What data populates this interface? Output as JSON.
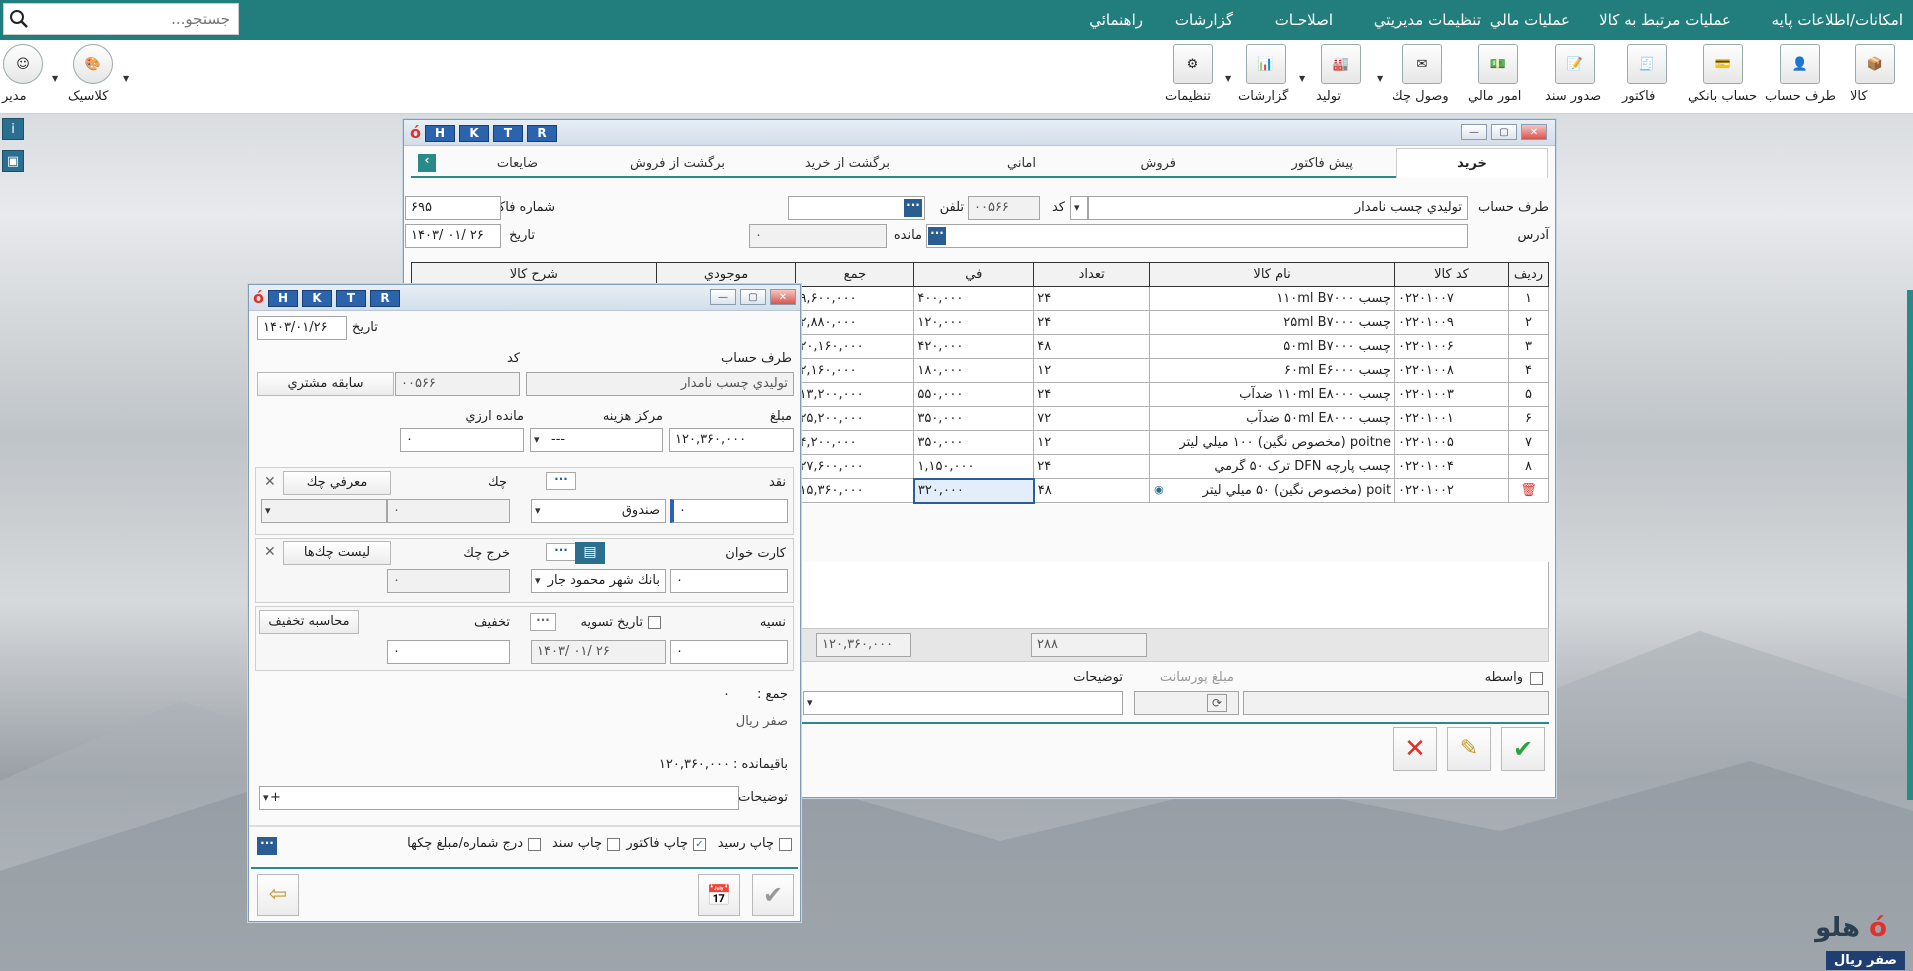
{
  "search": {
    "placeholder": "جستجو..."
  },
  "menu": [
    "امکانات/اطلاعات پايه",
    "عمليات مرتبط به کالا",
    "عمليات مالي",
    "تنظيمات مديريتي",
    "اصلاحـات",
    "گزارشات",
    "راهنمائي"
  ],
  "toolbar": {
    "items": [
      "کالا",
      "طرف حساب",
      "حساب بانکي",
      "فاکتور",
      "صدور سند",
      "امور مالي",
      "وصول چك",
      "توليد",
      "گزارشات",
      "تنظيمات"
    ],
    "theme": "کلاسيک",
    "user": "مدير"
  },
  "hk": [
    "H",
    "K",
    "T",
    "R"
  ],
  "main": {
    "tabs": [
      "خريد",
      "پيش فاکتور",
      "فروش",
      "اماني",
      "برگشت از خريد",
      "برگشت از فروش",
      "ضايعات"
    ],
    "party_label": "طرف حساب",
    "party": "توليدي چسب نامدار",
    "code_label": "کد",
    "code": "۰۰۵۶۶",
    "phone_label": "تلفن",
    "invoice_no_label": "شماره فاکتور",
    "invoice_no": "۶۹۵",
    "address_label": "آدرس",
    "remain_label": "مانده",
    "remain": "۰",
    "date_label": "تاريخ",
    "date": "۱۴۰۳/ ۰۱/ ۲۶",
    "columns": [
      "رديف",
      "کد کالا",
      "نام کالا",
      "تعداد",
      "في",
      "جمع",
      "موجودي",
      "شرح کالا"
    ],
    "rows": [
      {
        "no": "۱",
        "code": "۰۲۲۰۱۰۰۷",
        "name": "چسب ۱۱۰ml B۷۰۰۰",
        "qty": "۲۴",
        "price": "۴۰۰,۰۰۰",
        "total": "۹,۶۰۰,۰۰۰"
      },
      {
        "no": "۲",
        "code": "۰۲۲۰۱۰۰۹",
        "name": "چسب ۲۵ml B۷۰۰۰",
        "qty": "۲۴",
        "price": "۱۲۰,۰۰۰",
        "total": "۲,۸۸۰,۰۰۰"
      },
      {
        "no": "۳",
        "code": "۰۲۲۰۱۰۰۶",
        "name": "چسب ۵۰ml B۷۰۰۰",
        "qty": "۴۸",
        "price": "۴۲۰,۰۰۰",
        "total": "۲۰,۱۶۰,۰۰۰"
      },
      {
        "no": "۴",
        "code": "۰۲۲۰۱۰۰۸",
        "name": "چسب ۶۰ml E۶۰۰۰",
        "qty": "۱۲",
        "price": "۱۸۰,۰۰۰",
        "total": "۲,۱۶۰,۰۰۰"
      },
      {
        "no": "۵",
        "code": "۰۲۲۰۱۰۰۳",
        "name": "چسب ۱۱۰ml E۸۰۰۰ ضدآب",
        "qty": "۲۴",
        "price": "۵۵۰,۰۰۰",
        "total": "۱۳,۲۰۰,۰۰۰"
      },
      {
        "no": "۶",
        "code": "۰۲۲۰۱۰۰۱",
        "name": "چسب ۵۰ml E۸۰۰۰ ضدآب",
        "qty": "۷۲",
        "price": "۳۵۰,۰۰۰",
        "total": "۲۵,۲۰۰,۰۰۰"
      },
      {
        "no": "۷",
        "code": "۰۲۲۰۱۰۰۵",
        "name": "poitne (مخصوص نگين) ۱۰۰ ميلي ليتر",
        "qty": "۱۲",
        "price": "۳۵۰,۰۰۰",
        "total": "۴,۲۰۰,۰۰۰"
      },
      {
        "no": "۸",
        "code": "۰۲۲۰۱۰۰۴",
        "name": "چسب پارچه DFN ترک ۵۰ گرمي",
        "qty": "۲۴",
        "price": "۱,۱۵۰,۰۰۰",
        "total": "۲۷,۶۰۰,۰۰۰"
      },
      {
        "no": "",
        "code": "۰۲۲۰۱۰۰۲",
        "name": "poit (مخصوص نگين) ۵۰ ميلي ليتر",
        "qty": "۴۸",
        "price": "۳۲۰,۰۰۰",
        "total": "۱۵,۳۶۰,۰۰۰"
      }
    ],
    "sum_qty": "۲۸۸",
    "sum_total": "۱۲۰,۳۶۰,۰۰۰",
    "broker_label": "واسطه",
    "commission_label": "مبلغ پورسانت",
    "desc_label": "توضيحات"
  },
  "pay": {
    "date_label": "تاريخ",
    "date": "۱۴۰۳/۰۱/۲۶",
    "party_label": "طرف حساب",
    "party": "توليدي چسب نامدار",
    "code_label": "کد",
    "code": "۰۰۵۶۶",
    "history_btn": "سابقه مشتري",
    "amount_label": "مبلغ",
    "amount": "۱۲۰,۳۶۰,۰۰۰",
    "cost_center_label": "مرکز هزينه",
    "cost_center": "---",
    "fx_remain_label": "مانده ارزي",
    "fx_remain": "۰",
    "cash_label": "نقد",
    "cash": "۰",
    "cash_box": "صندوق",
    "cheque_label": "چك",
    "cheque_btn": "معرفي چك",
    "cheque": "۰",
    "card_label": "کارت خوان",
    "card": "۰",
    "bank": "بانك شهر محمود جار",
    "cheque_out_label": "خرج چك",
    "cheque_list_btn": "ليست چك‌ها",
    "cheque_out": "۰",
    "credit_label": "نسيه",
    "credit": "۰",
    "settle_label": "تاريخ تسويه",
    "settle_date": "۱۴۰۳/ ۰۱/ ۲۶",
    "discount_label": "تخفيف",
    "discount_btn": "محاسبه تخفيف",
    "discount": "۰",
    "sum_label": "جمع :",
    "sum": "۰",
    "sum_words": "صفر ريال",
    "balance_label": "باقيمانده :",
    "balance": "۱۲۰,۳۶۰,۰۰۰",
    "desc_label": "توضيحات",
    "desc": "+",
    "print_receipt": "چاپ رسيد",
    "print_invoice": "چاپ فاکتور",
    "print_doc": "چاپ سند",
    "insert_cheques": "درج شماره/مبلغ چکها"
  },
  "footer": {
    "brand": "هلو",
    "status": "صفر ريال"
  },
  "colors": {
    "accent": "#227d7d",
    "key": "#2b63ad",
    "red": "#e0322a",
    "green": "#2aa33f"
  }
}
